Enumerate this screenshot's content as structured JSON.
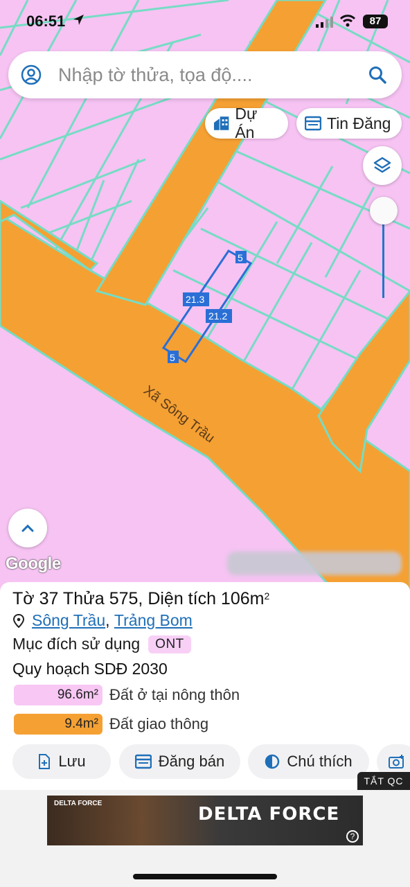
{
  "status": {
    "time": "06:51",
    "battery": "87"
  },
  "search": {
    "placeholder": "Nhập tờ thửa, tọa độ...."
  },
  "chips": {
    "du_an": "Dự Án",
    "tin_dang": "Tin Đăng"
  },
  "map": {
    "road_label": "Xã Sông Trầu",
    "dim_top": "5",
    "dim_bottom": "5",
    "dim_left": "21.3",
    "dim_right": "21.2",
    "google": "Google",
    "colors": {
      "residential": "#f6c3f3",
      "road": "#f5a033",
      "parcel_line": "#76dcc4",
      "selection": "#2a6fd6"
    }
  },
  "parcel": {
    "title_pre": "Tờ ",
    "sheet": "37",
    "title_mid": " Thửa ",
    "lot": "575",
    "title_area_label": ", Diện tích ",
    "area": "106m",
    "area_sup": "2",
    "commune": "Sông Trầu",
    "sep": ",",
    "district": "Trảng Bom",
    "purpose_label": "Mục đích sử dụng",
    "purpose_code": "ONT",
    "plan_title": "Quy hoạch SDĐ 2030"
  },
  "legend": [
    {
      "value": "96.6m²",
      "label": "Đất ở tại nông thôn",
      "color": "#f8c7f4"
    },
    {
      "value": "9.4m²",
      "label": "Đất giao thông",
      "color": "#f5a033"
    }
  ],
  "actions": {
    "save": "Lưu",
    "post": "Đăng bán",
    "legend": "Chú thích"
  },
  "ad": {
    "close": "TẮT QC",
    "title": "DELTA FORCE",
    "brand": "DELTA FORCE",
    "help": "?"
  }
}
